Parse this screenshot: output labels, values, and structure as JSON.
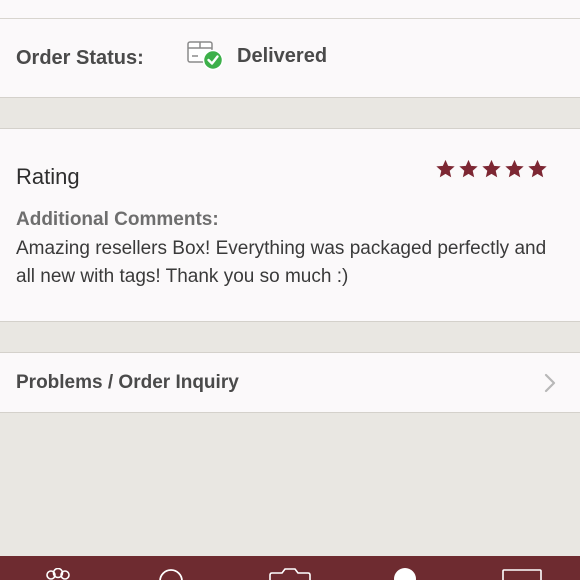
{
  "order_status": {
    "label": "Order Status:",
    "value": "Delivered",
    "icon": "delivered-box-check-icon",
    "check_color": "#3db04a"
  },
  "rating": {
    "title": "Rating",
    "stars": 5,
    "max_stars": 5,
    "star_color": "#7d2733",
    "comments_heading": "Additional Comments:",
    "comments_text": "Amazing resellers Box! Everything was packaged perfectly and all new with tags! Thank you so much :)"
  },
  "inquiry": {
    "label": "Problems / Order Inquiry",
    "icon": "chevron-right-icon"
  },
  "tabbar": {
    "background": "#6e2b30",
    "tabs": [
      {
        "icon": "community-icon"
      },
      {
        "icon": "search-icon"
      },
      {
        "icon": "camera-icon"
      },
      {
        "icon": "profile-icon"
      },
      {
        "icon": "news-icon"
      }
    ]
  }
}
